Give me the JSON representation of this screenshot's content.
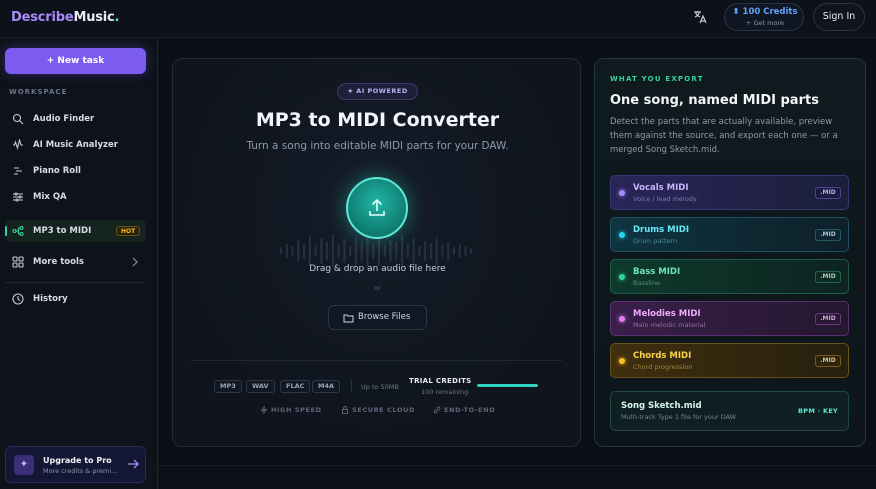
{
  "header": {
    "logo": {
      "part1": "Describe",
      "part2": "Music",
      "part3": "."
    },
    "credits": {
      "amount": "100 Credits",
      "sub": "+ Get more"
    },
    "signin_label": "Sign In"
  },
  "sidebar": {
    "new_task_label": "+ New task",
    "section_label": "WORKSPACE",
    "items": [
      {
        "label": "Audio Finder",
        "icon": "search-music-icon"
      },
      {
        "label": "AI Music Analyzer",
        "icon": "waveform-icon"
      },
      {
        "label": "Piano Roll",
        "icon": "piano-roll-icon"
      },
      {
        "label": "Mix QA",
        "icon": "sliders-icon"
      },
      {
        "label": "MP3 to MIDI",
        "icon": "nodes-icon",
        "badge": "HOT",
        "active": true
      },
      {
        "label": "More tools",
        "icon": "grid-icon"
      },
      {
        "label": "History",
        "icon": "clock-icon"
      }
    ],
    "upgrade": {
      "title": "Upgrade to Pro",
      "sub": "More credits & premi..."
    }
  },
  "main": {
    "pill": "★ AI POWERED",
    "title": "MP3 to MIDI Converter",
    "subtitle": "Turn a song into editable MIDI parts for your DAW.",
    "drag_text": "Drag & drop an audio file here",
    "or_text": "or",
    "browse_label": "Browse Files",
    "formats": [
      "MP3",
      "WAV",
      "FLAC",
      "M4A"
    ],
    "size_limit": "Up to 50MB",
    "trial": {
      "label": "TRIAL CREDITS",
      "remaining": "100 remaining",
      "fraction": 1.0
    },
    "features": [
      "HIGH SPEED",
      "SECURE CLOUD",
      "END-TO-END"
    ]
  },
  "export": {
    "kicker": "WHAT YOU EXPORT",
    "title": "One song, named MIDI parts",
    "desc": "Detect the parts that are actually available, preview them against the source, and export each one — or a merged Song Sketch.mid.",
    "parts": [
      {
        "name": "Vocals MIDI",
        "desc": "Voice / lead melody",
        "ext": ".MID",
        "color": "#a78bfa"
      },
      {
        "name": "Drums MIDI",
        "desc": "Drum pattern",
        "ext": ".MID",
        "color": "#22d3ee"
      },
      {
        "name": "Bass MIDI",
        "desc": "Bassline",
        "ext": ".MID",
        "color": "#34d399"
      },
      {
        "name": "Melodies MIDI",
        "desc": "Main melodic material",
        "ext": ".MID",
        "color": "#e879f9"
      },
      {
        "name": "Chords MIDI",
        "desc": "Chord progression",
        "ext": ".MID",
        "color": "#fbbf24"
      }
    ],
    "sketch": {
      "name": "Song Sketch.mid",
      "desc": "Multi-track Type 1 file for your DAW",
      "tag": "BPM · KEY"
    }
  }
}
